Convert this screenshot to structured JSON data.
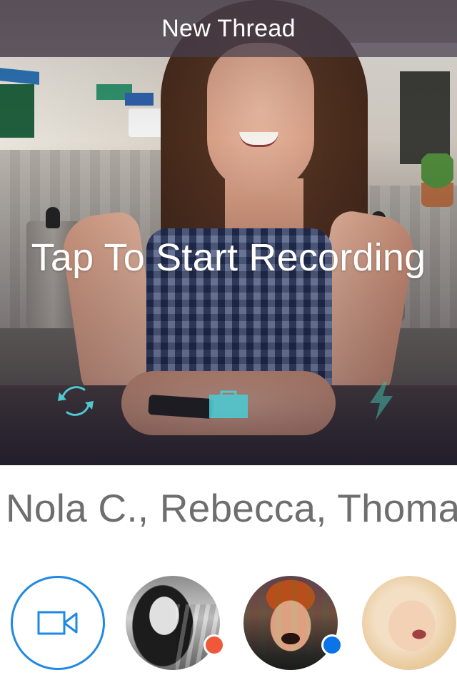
{
  "header": {
    "title": "New Thread"
  },
  "camera": {
    "hint": "Tap To Start Recording",
    "controls": {
      "flip_icon": "camera-flip-icon",
      "capture_icon": "capture-box-icon",
      "flash_icon": "flash-icon"
    }
  },
  "recipients": {
    "text": "Nola C., Rebecca, Thomas"
  },
  "contacts": {
    "new_video": {
      "icon": "video-camera-icon"
    },
    "items": [
      {
        "status_color": "#f0583a"
      },
      {
        "status_color": "#0a74e8"
      },
      {}
    ]
  },
  "colors": {
    "accent": "#1e88e5",
    "title_bar": "#463e4e",
    "recipients_text": "#6e6e6e",
    "teal_controls": "#4fc8d0"
  }
}
